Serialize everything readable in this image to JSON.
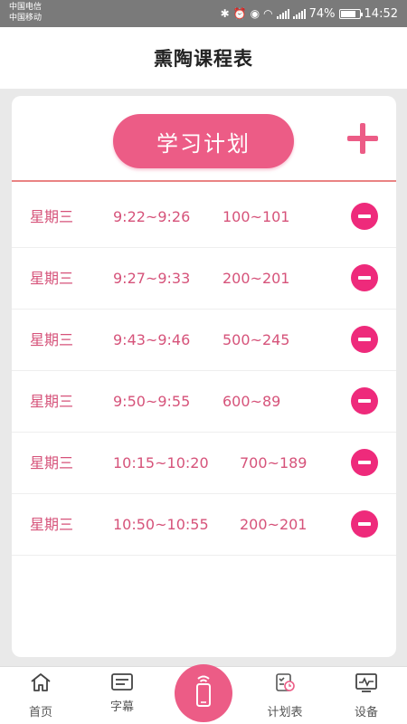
{
  "status_bar": {
    "carrier1": "中国电信",
    "carrier2": "中国移动",
    "battery": "74%",
    "time": "14:52",
    "battery_level": 0.74
  },
  "header": {
    "title": "熏陶课程表"
  },
  "card": {
    "plan_label": "学习计划",
    "add_icon": "plus-icon",
    "remove_icon": "minus-circle-icon"
  },
  "rows": [
    {
      "day": "星期三",
      "time": "9:22~9:26",
      "range": "100~101"
    },
    {
      "day": "星期三",
      "time": "9:27~9:33",
      "range": "200~201"
    },
    {
      "day": "星期三",
      "time": "9:43~9:46",
      "range": "500~245"
    },
    {
      "day": "星期三",
      "time": "9:50~9:55",
      "range": "600~89"
    },
    {
      "day": "星期三",
      "time": "10:15~10:20",
      "range": "700~189"
    },
    {
      "day": "星期三",
      "time": "10:50~10:55",
      "range": "200~201"
    }
  ],
  "nav": {
    "home": "首页",
    "subtitle": "字幕",
    "schedule": "计划表",
    "device": "设备",
    "center_icon": "phone-remote-icon"
  },
  "colors": {
    "accent": "#ec5c86",
    "row_text": "#d6537a",
    "remove": "#ee2a7b",
    "divider": "#e98383"
  }
}
